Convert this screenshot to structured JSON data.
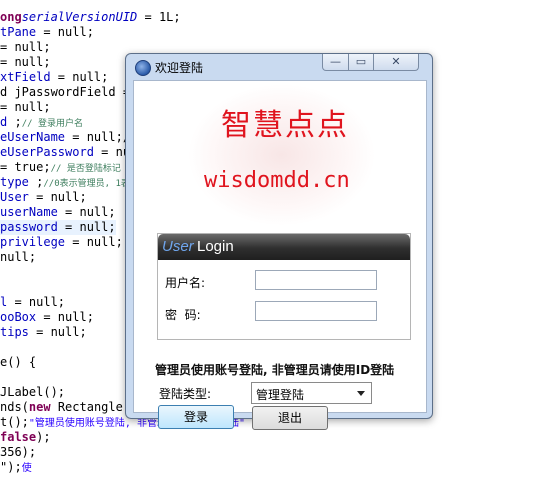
{
  "editor": {
    "lines": [
      {
        "pre": "",
        "kw": "ong",
        "fld": "serialVersionUID",
        "post": " = 1L;"
      },
      {
        "pre": "",
        "kw": "",
        "fld2": "tPane",
        "post": " = null;"
      },
      {
        "pre": "",
        "kw": "",
        "fld2": "",
        "post": "= null;"
      },
      {
        "pre": "",
        "kw": "",
        "fld2": "",
        "post": "= null;"
      },
      {
        "pre": "",
        "kw": "",
        "fld2": "xtField",
        "post": " = null;"
      },
      {
        "pre": "d jPasswordField = ",
        "kw": "",
        "fld2": "",
        "post": "null;"
      },
      {
        "pre": "",
        "kw": "",
        "fld2": "",
        "post": "= null;"
      },
      {
        "pre": "",
        "kw": "",
        "fld2": "d",
        "post": " ;",
        "cmt": "// 登录用户名"
      },
      {
        "pre": "",
        "kw": "",
        "fld2": "eUserName",
        "post": " = null;/"
      },
      {
        "pre": "",
        "kw": "",
        "fld2": "eUserPassword",
        "post": " = nul"
      },
      {
        "pre": "",
        "kw": "",
        "fld2": "",
        "post": "= true;",
        "cmt": "// 是否登陆标记"
      },
      {
        "pre": "",
        "kw": "",
        "fld2": "type",
        "post": " ;",
        "cmt": "//0表示管理员, 1表"
      },
      {
        "pre": "",
        "kw": "",
        "fld2": "User",
        "post": " = null;"
      },
      {
        "pre": "",
        "kw": "",
        "fld2": "userName",
        "post": " = null;"
      },
      {
        "pre": "",
        "kw": "",
        "fld2": "password",
        "post": " = null;"
      },
      {
        "pre": "",
        "kw": "",
        "fld2": "privilege",
        "post": " = null;"
      },
      {
        "pre": "",
        "kw": "",
        "fld2": "",
        "post": "null;"
      },
      {
        "pre": "",
        "kw": "",
        "fld2": "",
        "post": ""
      },
      {
        "pre": "",
        "kw": "",
        "fld2": "",
        "post": ""
      },
      {
        "pre": "",
        "kw": "",
        "fld2": "l",
        "post": " = null;"
      },
      {
        "pre": "",
        "kw": "",
        "fld2": "ooBox",
        "post": " = null;"
      },
      {
        "pre": "",
        "kw": "",
        "fld2": "tips",
        "post": " = null;"
      },
      {
        "pre": "",
        "kw": "",
        "fld2": "",
        "post": ""
      },
      {
        "pre": "e() {",
        "kw": "",
        "fld2": "",
        "post": ""
      },
      {
        "pre": "",
        "kw": "",
        "fld2": "",
        "post": ""
      },
      {
        "pre": "JLabel();",
        "kw": "",
        "fld2": "",
        "post": ""
      },
      {
        "pre": "nds(",
        "kw": "new",
        "fld2": "",
        "post": " Rectangle(1"
      },
      {
        "pre": "t(",
        "kw": "",
        "fld2": "",
        "post": ");",
        "str": "\"管理员使用账号登陆, 非管理员请使用ID登陆\""
      },
      {
        "pre": "",
        "kw": "false",
        "fld2": "",
        "post": ");"
      },
      {
        "pre": "356);",
        "kw": "",
        "fld2": "",
        "post": ""
      },
      {
        "pre": "",
        "kw": "",
        "fld2": "",
        "post": "\");",
        "str": "使"
      }
    ]
  },
  "window": {
    "title": "欢迎登陆",
    "min_glyph": "—",
    "max_glyph": "▭",
    "close_glyph": "✕"
  },
  "banner": {
    "title_cn": "智慧点点",
    "title_en": "wisdomdd.cn"
  },
  "login_panel": {
    "header_user": "User",
    "header_login": "Login",
    "username_label": "用户名:",
    "password_label": "密  码:",
    "username_value": "",
    "password_value": ""
  },
  "notice": "管理员使用账号登陆, 非管理员请使用ID登陆",
  "login_type": {
    "label": "登陆类型:",
    "selected": "管理登陆"
  },
  "buttons": {
    "login": "登录",
    "exit": "退出"
  },
  "colors": {
    "brand_red": "#e0141e",
    "window_frame": "#c9daf0",
    "header_dark": "#2f2f2f",
    "user_blue": "#6fa5ec"
  }
}
